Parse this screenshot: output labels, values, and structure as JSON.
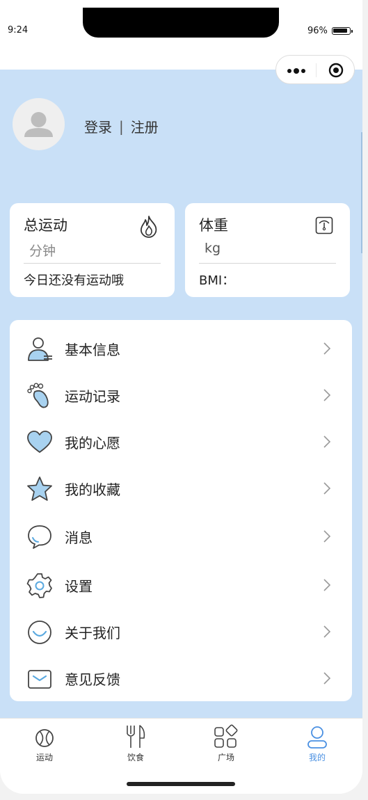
{
  "status": {
    "time": "9:24",
    "battery": "96%",
    "battery_level": 0.96
  },
  "profile": {
    "login": "登录",
    "separator": "|",
    "register": "注册"
  },
  "cards": {
    "exercise": {
      "title": "总运动",
      "unit": "分钟",
      "note": "今日还没有运动哦",
      "icon": "flame-icon"
    },
    "weight": {
      "title": "体重",
      "unit": "kg",
      "note": "BMI：",
      "icon": "scale-icon"
    }
  },
  "menu": [
    {
      "label": "基本信息",
      "icon": "user-info-icon"
    },
    {
      "label": "运动记录",
      "icon": "footprint-icon"
    },
    {
      "label": "我的心愿",
      "icon": "heart-icon"
    },
    {
      "label": "我的收藏",
      "icon": "star-icon"
    },
    {
      "label": "消息",
      "icon": "message-icon"
    },
    {
      "label": "设置",
      "icon": "gear-icon"
    },
    {
      "label": "关于我们",
      "icon": "smile-icon"
    },
    {
      "label": "意见反馈",
      "icon": "mail-icon"
    }
  ],
  "tabs": [
    {
      "label": "运动",
      "icon": "ball-icon"
    },
    {
      "label": "饮食",
      "icon": "fork-knife-icon"
    },
    {
      "label": "广场",
      "icon": "apps-icon"
    },
    {
      "label": "我的",
      "icon": "person-icon",
      "active": true
    }
  ],
  "colors": {
    "background": "#c9e0f7",
    "accent": "#4a90e2",
    "icon_fill": "#a8d2f0",
    "icon_stroke": "#444444"
  }
}
